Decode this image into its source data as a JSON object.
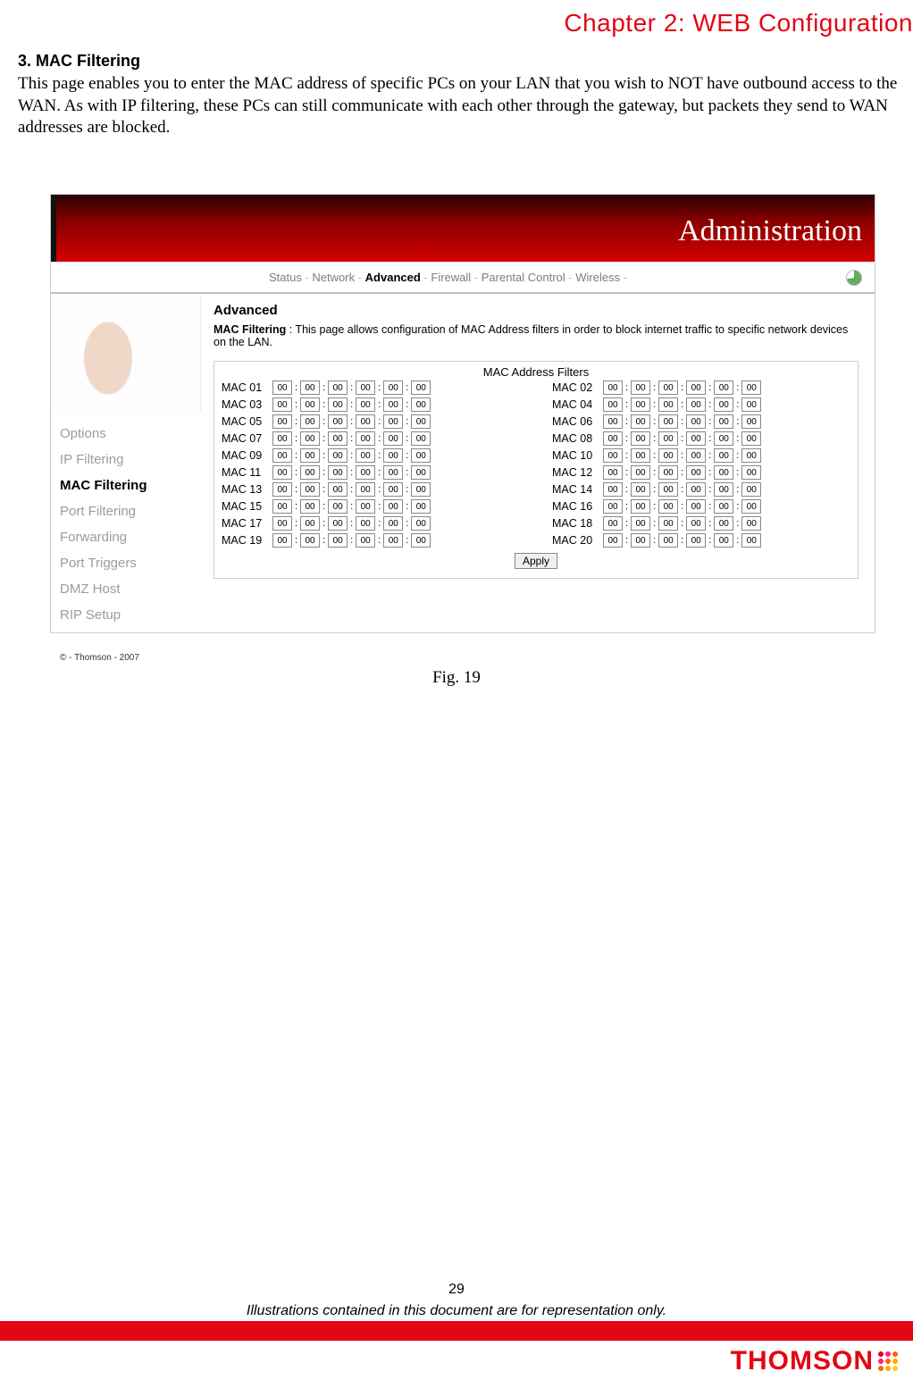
{
  "chapter": "Chapter 2: WEB Configuration",
  "section": "3. MAC Filtering",
  "paragraph": "This page enables you to enter the MAC address of specific PCs on your LAN that you wish to NOT have outbound access to the WAN. As with IP filtering, these PCs can still communicate with each other through the gateway, but packets they send to WAN addresses are blocked.",
  "figure_caption": "Fig. 19",
  "page_number": "29",
  "disclaimer": "Illustrations contained in this document are for representation only.",
  "brand": "THOMSON",
  "shot": {
    "banner": "Administration",
    "nav": [
      "Status",
      "Network",
      "Advanced",
      "Firewall",
      "Parental Control",
      "Wireless"
    ],
    "nav_active_index": 2,
    "sidebar": [
      "Options",
      "IP Filtering",
      "MAC Filtering",
      "Port Filtering",
      "Forwarding",
      "Port Triggers",
      "DMZ Host",
      "RIP Setup"
    ],
    "sidebar_active_index": 2,
    "copyright": "© - Thomson - 2007",
    "title": "Advanced",
    "desc_label": "MAC Filtering",
    "desc_text": " : This page allows configuration of MAC Address filters in order to block internet traffic to specific network devices on the LAN.",
    "filters_title": "MAC Address Filters",
    "filters": [
      {
        "n": "01",
        "v": [
          "00",
          "00",
          "00",
          "00",
          "00",
          "00"
        ]
      },
      {
        "n": "02",
        "v": [
          "00",
          "00",
          "00",
          "00",
          "00",
          "00"
        ]
      },
      {
        "n": "03",
        "v": [
          "00",
          "00",
          "00",
          "00",
          "00",
          "00"
        ]
      },
      {
        "n": "04",
        "v": [
          "00",
          "00",
          "00",
          "00",
          "00",
          "00"
        ]
      },
      {
        "n": "05",
        "v": [
          "00",
          "00",
          "00",
          "00",
          "00",
          "00"
        ]
      },
      {
        "n": "06",
        "v": [
          "00",
          "00",
          "00",
          "00",
          "00",
          "00"
        ]
      },
      {
        "n": "07",
        "v": [
          "00",
          "00",
          "00",
          "00",
          "00",
          "00"
        ]
      },
      {
        "n": "08",
        "v": [
          "00",
          "00",
          "00",
          "00",
          "00",
          "00"
        ]
      },
      {
        "n": "09",
        "v": [
          "00",
          "00",
          "00",
          "00",
          "00",
          "00"
        ]
      },
      {
        "n": "10",
        "v": [
          "00",
          "00",
          "00",
          "00",
          "00",
          "00"
        ]
      },
      {
        "n": "11",
        "v": [
          "00",
          "00",
          "00",
          "00",
          "00",
          "00"
        ]
      },
      {
        "n": "12",
        "v": [
          "00",
          "00",
          "00",
          "00",
          "00",
          "00"
        ]
      },
      {
        "n": "13",
        "v": [
          "00",
          "00",
          "00",
          "00",
          "00",
          "00"
        ]
      },
      {
        "n": "14",
        "v": [
          "00",
          "00",
          "00",
          "00",
          "00",
          "00"
        ]
      },
      {
        "n": "15",
        "v": [
          "00",
          "00",
          "00",
          "00",
          "00",
          "00"
        ]
      },
      {
        "n": "16",
        "v": [
          "00",
          "00",
          "00",
          "00",
          "00",
          "00"
        ]
      },
      {
        "n": "17",
        "v": [
          "00",
          "00",
          "00",
          "00",
          "00",
          "00"
        ]
      },
      {
        "n": "18",
        "v": [
          "00",
          "00",
          "00",
          "00",
          "00",
          "00"
        ]
      },
      {
        "n": "19",
        "v": [
          "00",
          "00",
          "00",
          "00",
          "00",
          "00"
        ]
      },
      {
        "n": "20",
        "v": [
          "00",
          "00",
          "00",
          "00",
          "00",
          "00"
        ]
      }
    ],
    "apply": "Apply"
  }
}
